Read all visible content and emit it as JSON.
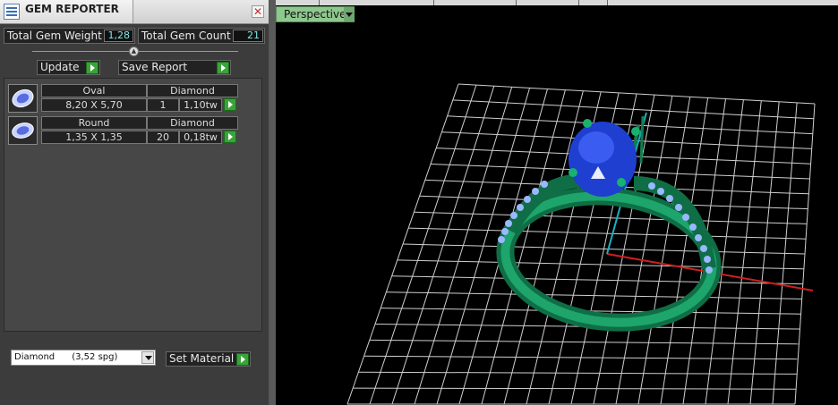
{
  "panel": {
    "title": "GEM REPORTER",
    "total_weight_label": "Total Gem Weight",
    "total_weight_value": "1,28",
    "total_count_label": "Total Gem Count",
    "total_count_value": "21",
    "update_label": "Update",
    "save_report_label": "Save Report",
    "gems": [
      {
        "shape": "Oval",
        "material": "Diamond",
        "size": "8,20 X 5,70",
        "count": "1",
        "weight": "1,10tw"
      },
      {
        "shape": "Round",
        "material": "Diamond",
        "size": "1,35 X 1,35",
        "count": "20",
        "weight": "0,18tw"
      }
    ],
    "material_select": "Diamond      (3,52 spg)",
    "set_material_label": "Set Material"
  },
  "viewport": {
    "view_label": "Perspective"
  },
  "colors": {
    "ring_green": "#138a55",
    "gem_blue": "#1f3fd0",
    "accent_stones": "#9ab8ff",
    "grid": "#cfcfcf",
    "axis_x": "#d02020",
    "axis_y": "#1ab0c0"
  }
}
